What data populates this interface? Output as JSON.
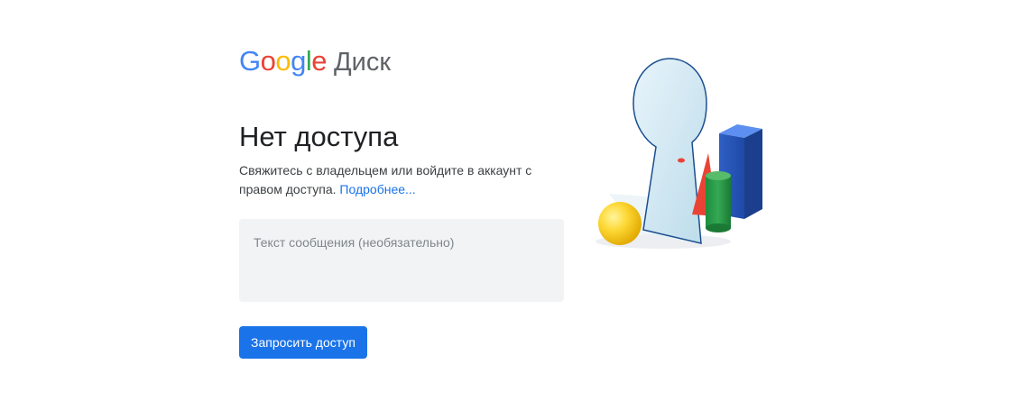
{
  "brand": {
    "google_letters": [
      {
        "char": "G",
        "color": "#4285F4"
      },
      {
        "char": "o",
        "color": "#EA4335"
      },
      {
        "char": "o",
        "color": "#FBBC05"
      },
      {
        "char": "g",
        "color": "#4285F4"
      },
      {
        "char": "l",
        "color": "#34A853"
      },
      {
        "char": "e",
        "color": "#EA4335"
      }
    ],
    "product": "Диск"
  },
  "main": {
    "title": "Нет доступа",
    "description": "Свяжитесь с владельцем или войдите в аккаунт с правом доступа.",
    "learn_more": "Подробнее...",
    "message_placeholder": "Текст сообщения (необязательно)",
    "request_button": "Запросить доступ"
  },
  "illustration": {
    "icon": "keyhole-illustration"
  },
  "colors": {
    "accent": "#1a73e8",
    "heading": "#202124",
    "body_text": "#3c4043",
    "field_bg": "#f1f3f4"
  }
}
